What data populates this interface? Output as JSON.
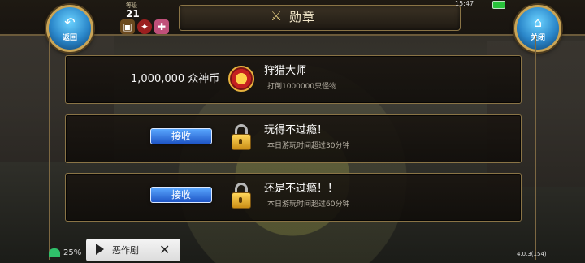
{
  "header": {
    "title": "勋章",
    "back_label": "返回",
    "close_label": "关闭",
    "level_label": "等级",
    "level_value": "21"
  },
  "status": {
    "time": "15:47",
    "version": "4.0.3(154)",
    "net_percent": "25%"
  },
  "achievements": [
    {
      "reward": "1,000,000 众神币",
      "title": "狩猎大师",
      "desc": "打倒1000000只怪物",
      "state": "reward-medal"
    },
    {
      "button_label": "接收",
      "title": "玩得不过瘾！",
      "desc": "本日游玩时间超过30分钟",
      "state": "locked"
    },
    {
      "button_label": "接收",
      "title": "还是不过瘾！！",
      "desc": "本日游玩时间超过60分钟",
      "state": "locked"
    }
  ],
  "bottom_panel": {
    "label": "恶作剧",
    "close_glyph": "✕"
  },
  "colors": {
    "accent_gold": "#c9a456",
    "button_blue": "#1f56c6"
  }
}
